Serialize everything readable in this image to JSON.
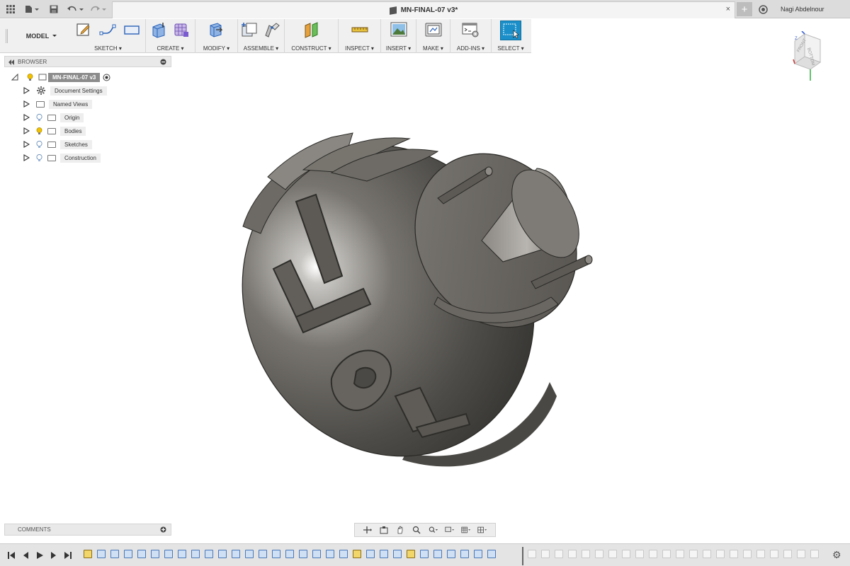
{
  "app": {
    "document_title": "MN-FINAL-07 v3*",
    "user_name": "Nagi Abdelnour",
    "tab_close_glyph": "×",
    "new_tab_glyph": "+"
  },
  "toolbar": {
    "workspace": "MODEL",
    "groups": [
      {
        "label": "SKETCH",
        "icons": [
          "sketch-create-icon",
          "line-icon",
          "rectangle-icon"
        ]
      },
      {
        "label": "CREATE",
        "icons": [
          "extrude-icon",
          "form-icon"
        ]
      },
      {
        "label": "MODIFY",
        "icons": [
          "press-pull-icon"
        ]
      },
      {
        "label": "ASSEMBLE",
        "icons": [
          "new-component-icon",
          "joint-icon"
        ]
      },
      {
        "label": "CONSTRUCT",
        "icons": [
          "offset-plane-icon"
        ]
      },
      {
        "label": "INSPECT",
        "icons": [
          "measure-icon"
        ]
      },
      {
        "label": "INSERT",
        "icons": [
          "insert-image-icon"
        ]
      },
      {
        "label": "MAKE",
        "icons": [
          "print-3d-icon"
        ]
      },
      {
        "label": "ADD-INS",
        "icons": [
          "scripts-icon"
        ]
      },
      {
        "label": "SELECT",
        "icons": [
          "select-icon"
        ]
      }
    ]
  },
  "browser": {
    "title": "BROWSER",
    "root": "MN-FINAL-07 v3",
    "items": [
      {
        "label": "Document Settings",
        "icon": "gear-icon"
      },
      {
        "label": "Named Views",
        "icon": "folder-icon"
      },
      {
        "label": "Origin",
        "icon": "folder-icon"
      },
      {
        "label": "Bodies",
        "icon": "folder-icon"
      },
      {
        "label": "Sketches",
        "icon": "folder-icon"
      },
      {
        "label": "Construction",
        "icon": "folder-icon"
      }
    ]
  },
  "comments": {
    "title": "COMMENTS"
  },
  "viewcube": {
    "faces": [
      "FRONT",
      "BOTTOM"
    ]
  },
  "colors": {
    "select_accent": "#1a8fc9",
    "visible_bulb": "#f2c200",
    "hidden_bulb": "#9ab6d6",
    "model_body": "#6e6b66"
  }
}
